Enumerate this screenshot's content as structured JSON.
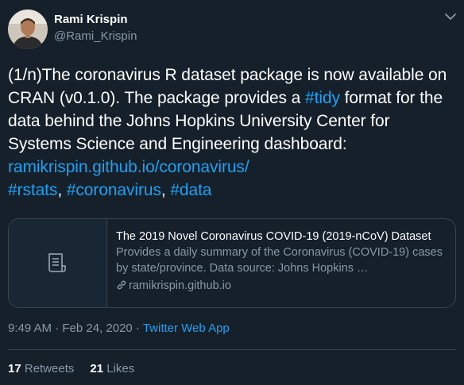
{
  "author": {
    "name": "Rami Krispin",
    "handle": "@Rami_Krispin"
  },
  "tweet": {
    "text_part1": "(1/n)The coronavirus R dataset package is now available on CRAN (v0.1.0). The package provides a ",
    "hashtag_tidy": "#tidy",
    "text_part2": " format for the data behind the Johns Hopkins University Center for Systems Science and Engineering dashboard:",
    "link": "ramikrispin.github.io/coronavirus/",
    "hashtag_rstats": "#rstats",
    "sep1": ", ",
    "hashtag_coronavirus": "#coronavirus",
    "sep2": ", ",
    "hashtag_data": "#data"
  },
  "card": {
    "title": "The 2019 Novel Coronavirus COVID-19 (2019-nCoV) Dataset",
    "description": "Provides a daily summary of the Coronavirus (COVID-19) cases by state/province. Data source: Johns Hopkins …",
    "domain": "ramikrispin.github.io",
    "thumb_icon": "document-icon",
    "domain_icon": "link-icon"
  },
  "meta": {
    "time_date": "9:49 AM · Feb 24, 2020 · ",
    "app": "Twitter Web App"
  },
  "stats": {
    "retweets_count": "17",
    "retweets_label": " Retweets",
    "likes_count": "21",
    "likes_label": " Likes"
  },
  "menu_icon": "chevron-down-icon",
  "colors": {
    "background": "#15202b",
    "accent": "#1da1f2",
    "muted": "#8899a6",
    "border": "#38444d"
  }
}
